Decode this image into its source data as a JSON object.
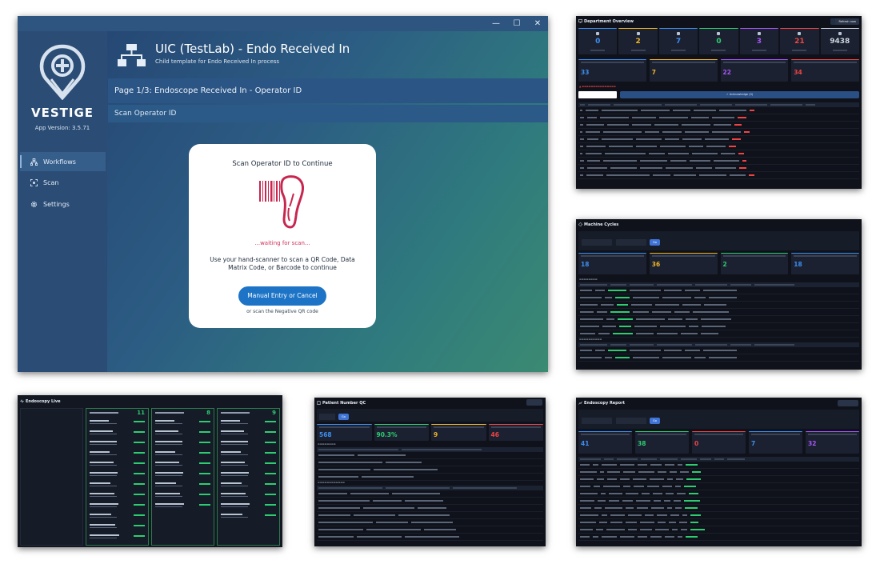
{
  "main": {
    "window_controls": {
      "minimize": "—",
      "maximize": "☐",
      "close": "✕"
    },
    "brand": "VESTIGE",
    "app_version": "App Version: 3.5.71",
    "nav": [
      {
        "label": "Workflows",
        "icon": "sitemap-icon",
        "active": true
      },
      {
        "label": "Scan",
        "icon": "scan-icon",
        "active": false
      },
      {
        "label": "Settings",
        "icon": "gear-icon",
        "active": false
      }
    ],
    "title": "UIC (TestLab) - Endo Received In",
    "subtitle": "Child template for Endo Received In process",
    "page_label": "Page 1/3: Endoscope Received In - Operator ID",
    "scan_label": "Scan Operator ID",
    "modal": {
      "title": "Scan Operator ID to Continue",
      "waiting": "...waiting for scan...",
      "description": "Use your hand-scanner to scan a QR Code, Data Matrix Code, or Barcode to continue",
      "button": "Manual Entry or Cancel",
      "alt": "or scan the Negative QR code"
    },
    "colors": {
      "accent": "#1d74c6",
      "waiting": "#d0305a"
    }
  },
  "dept": {
    "title": "Department Overview",
    "refresh": "Refresh now",
    "kpis": [
      {
        "value": "0",
        "color": "#3d8ef0"
      },
      {
        "value": "2",
        "color": "#f0b429"
      },
      {
        "value": "7",
        "color": "#3d8ef0"
      },
      {
        "value": "0",
        "color": "#2ecc71"
      },
      {
        "value": "3",
        "color": "#a855f7"
      },
      {
        "value": "21",
        "color": "#ef4444"
      },
      {
        "value": "9438",
        "color": "#cbd5e1"
      }
    ],
    "cards": [
      {
        "value": "33",
        "color": "#3d8ef0"
      },
      {
        "value": "7",
        "color": "#f0b429"
      },
      {
        "value": "22",
        "color": "#a855f7"
      },
      {
        "value": "34",
        "color": "#ef4444"
      }
    ],
    "ack_button": "✓ Acknowledge (0)"
  },
  "cycles": {
    "title": "Machine Cycles",
    "go": "Go",
    "kpis": [
      {
        "value": "18",
        "color": "#3d8ef0"
      },
      {
        "value": "36",
        "color": "#f0b429"
      },
      {
        "value": "2",
        "color": "#2ecc71"
      },
      {
        "value": "18",
        "color": "#3d8ef0"
      }
    ]
  },
  "live": {
    "title": "Endoscopy Live",
    "columns": [
      {
        "count": "11"
      },
      {
        "count": "8"
      },
      {
        "count": "9"
      }
    ]
  },
  "patient": {
    "title": "Patient Number QC",
    "go": "Go",
    "kpis": [
      {
        "value": "568",
        "color": "#3d8ef0"
      },
      {
        "value": "90.3%",
        "color": "#2ecc71"
      },
      {
        "value": "9",
        "color": "#f0b429"
      },
      {
        "value": "46",
        "color": "#ef4444"
      }
    ]
  },
  "report": {
    "title": "Endoscopy Report",
    "go": "Go",
    "kpis": [
      {
        "value": "41",
        "color": "#3d8ef0"
      },
      {
        "value": "38",
        "color": "#2ecc71"
      },
      {
        "value": "0",
        "color": "#ef4444"
      },
      {
        "value": "7",
        "color": "#3d8ef0"
      },
      {
        "value": "32",
        "color": "#a855f7"
      }
    ]
  }
}
